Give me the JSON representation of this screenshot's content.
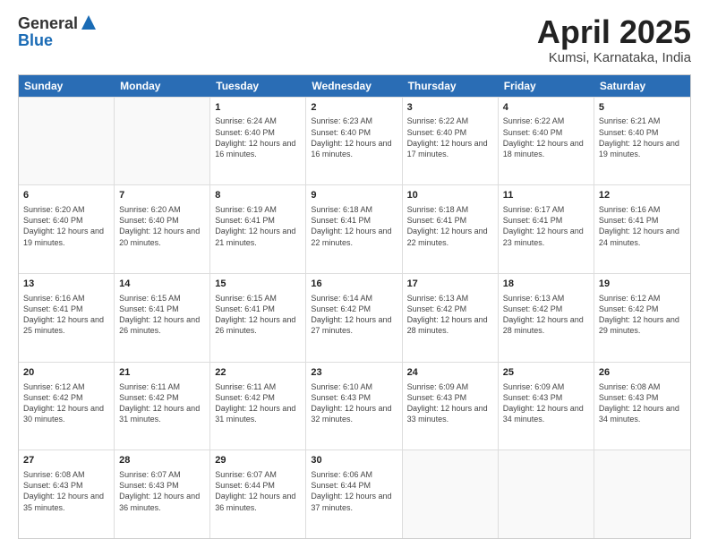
{
  "header": {
    "logo": {
      "line1": "General",
      "line2": "Blue"
    },
    "title": "April 2025",
    "location": "Kumsi, Karnataka, India"
  },
  "weekdays": [
    "Sunday",
    "Monday",
    "Tuesday",
    "Wednesday",
    "Thursday",
    "Friday",
    "Saturday"
  ],
  "rows": [
    [
      {
        "day": "",
        "sunrise": "",
        "sunset": "",
        "daylight": ""
      },
      {
        "day": "",
        "sunrise": "",
        "sunset": "",
        "daylight": ""
      },
      {
        "day": "1",
        "sunrise": "Sunrise: 6:24 AM",
        "sunset": "Sunset: 6:40 PM",
        "daylight": "Daylight: 12 hours and 16 minutes."
      },
      {
        "day": "2",
        "sunrise": "Sunrise: 6:23 AM",
        "sunset": "Sunset: 6:40 PM",
        "daylight": "Daylight: 12 hours and 16 minutes."
      },
      {
        "day": "3",
        "sunrise": "Sunrise: 6:22 AM",
        "sunset": "Sunset: 6:40 PM",
        "daylight": "Daylight: 12 hours and 17 minutes."
      },
      {
        "day": "4",
        "sunrise": "Sunrise: 6:22 AM",
        "sunset": "Sunset: 6:40 PM",
        "daylight": "Daylight: 12 hours and 18 minutes."
      },
      {
        "day": "5",
        "sunrise": "Sunrise: 6:21 AM",
        "sunset": "Sunset: 6:40 PM",
        "daylight": "Daylight: 12 hours and 19 minutes."
      }
    ],
    [
      {
        "day": "6",
        "sunrise": "Sunrise: 6:20 AM",
        "sunset": "Sunset: 6:40 PM",
        "daylight": "Daylight: 12 hours and 19 minutes."
      },
      {
        "day": "7",
        "sunrise": "Sunrise: 6:20 AM",
        "sunset": "Sunset: 6:40 PM",
        "daylight": "Daylight: 12 hours and 20 minutes."
      },
      {
        "day": "8",
        "sunrise": "Sunrise: 6:19 AM",
        "sunset": "Sunset: 6:41 PM",
        "daylight": "Daylight: 12 hours and 21 minutes."
      },
      {
        "day": "9",
        "sunrise": "Sunrise: 6:18 AM",
        "sunset": "Sunset: 6:41 PM",
        "daylight": "Daylight: 12 hours and 22 minutes."
      },
      {
        "day": "10",
        "sunrise": "Sunrise: 6:18 AM",
        "sunset": "Sunset: 6:41 PM",
        "daylight": "Daylight: 12 hours and 22 minutes."
      },
      {
        "day": "11",
        "sunrise": "Sunrise: 6:17 AM",
        "sunset": "Sunset: 6:41 PM",
        "daylight": "Daylight: 12 hours and 23 minutes."
      },
      {
        "day": "12",
        "sunrise": "Sunrise: 6:16 AM",
        "sunset": "Sunset: 6:41 PM",
        "daylight": "Daylight: 12 hours and 24 minutes."
      }
    ],
    [
      {
        "day": "13",
        "sunrise": "Sunrise: 6:16 AM",
        "sunset": "Sunset: 6:41 PM",
        "daylight": "Daylight: 12 hours and 25 minutes."
      },
      {
        "day": "14",
        "sunrise": "Sunrise: 6:15 AM",
        "sunset": "Sunset: 6:41 PM",
        "daylight": "Daylight: 12 hours and 26 minutes."
      },
      {
        "day": "15",
        "sunrise": "Sunrise: 6:15 AM",
        "sunset": "Sunset: 6:41 PM",
        "daylight": "Daylight: 12 hours and 26 minutes."
      },
      {
        "day": "16",
        "sunrise": "Sunrise: 6:14 AM",
        "sunset": "Sunset: 6:42 PM",
        "daylight": "Daylight: 12 hours and 27 minutes."
      },
      {
        "day": "17",
        "sunrise": "Sunrise: 6:13 AM",
        "sunset": "Sunset: 6:42 PM",
        "daylight": "Daylight: 12 hours and 28 minutes."
      },
      {
        "day": "18",
        "sunrise": "Sunrise: 6:13 AM",
        "sunset": "Sunset: 6:42 PM",
        "daylight": "Daylight: 12 hours and 28 minutes."
      },
      {
        "day": "19",
        "sunrise": "Sunrise: 6:12 AM",
        "sunset": "Sunset: 6:42 PM",
        "daylight": "Daylight: 12 hours and 29 minutes."
      }
    ],
    [
      {
        "day": "20",
        "sunrise": "Sunrise: 6:12 AM",
        "sunset": "Sunset: 6:42 PM",
        "daylight": "Daylight: 12 hours and 30 minutes."
      },
      {
        "day": "21",
        "sunrise": "Sunrise: 6:11 AM",
        "sunset": "Sunset: 6:42 PM",
        "daylight": "Daylight: 12 hours and 31 minutes."
      },
      {
        "day": "22",
        "sunrise": "Sunrise: 6:11 AM",
        "sunset": "Sunset: 6:42 PM",
        "daylight": "Daylight: 12 hours and 31 minutes."
      },
      {
        "day": "23",
        "sunrise": "Sunrise: 6:10 AM",
        "sunset": "Sunset: 6:43 PM",
        "daylight": "Daylight: 12 hours and 32 minutes."
      },
      {
        "day": "24",
        "sunrise": "Sunrise: 6:09 AM",
        "sunset": "Sunset: 6:43 PM",
        "daylight": "Daylight: 12 hours and 33 minutes."
      },
      {
        "day": "25",
        "sunrise": "Sunrise: 6:09 AM",
        "sunset": "Sunset: 6:43 PM",
        "daylight": "Daylight: 12 hours and 34 minutes."
      },
      {
        "day": "26",
        "sunrise": "Sunrise: 6:08 AM",
        "sunset": "Sunset: 6:43 PM",
        "daylight": "Daylight: 12 hours and 34 minutes."
      }
    ],
    [
      {
        "day": "27",
        "sunrise": "Sunrise: 6:08 AM",
        "sunset": "Sunset: 6:43 PM",
        "daylight": "Daylight: 12 hours and 35 minutes."
      },
      {
        "day": "28",
        "sunrise": "Sunrise: 6:07 AM",
        "sunset": "Sunset: 6:43 PM",
        "daylight": "Daylight: 12 hours and 36 minutes."
      },
      {
        "day": "29",
        "sunrise": "Sunrise: 6:07 AM",
        "sunset": "Sunset: 6:44 PM",
        "daylight": "Daylight: 12 hours and 36 minutes."
      },
      {
        "day": "30",
        "sunrise": "Sunrise: 6:06 AM",
        "sunset": "Sunset: 6:44 PM",
        "daylight": "Daylight: 12 hours and 37 minutes."
      },
      {
        "day": "",
        "sunrise": "",
        "sunset": "",
        "daylight": ""
      },
      {
        "day": "",
        "sunrise": "",
        "sunset": "",
        "daylight": ""
      },
      {
        "day": "",
        "sunrise": "",
        "sunset": "",
        "daylight": ""
      }
    ]
  ]
}
